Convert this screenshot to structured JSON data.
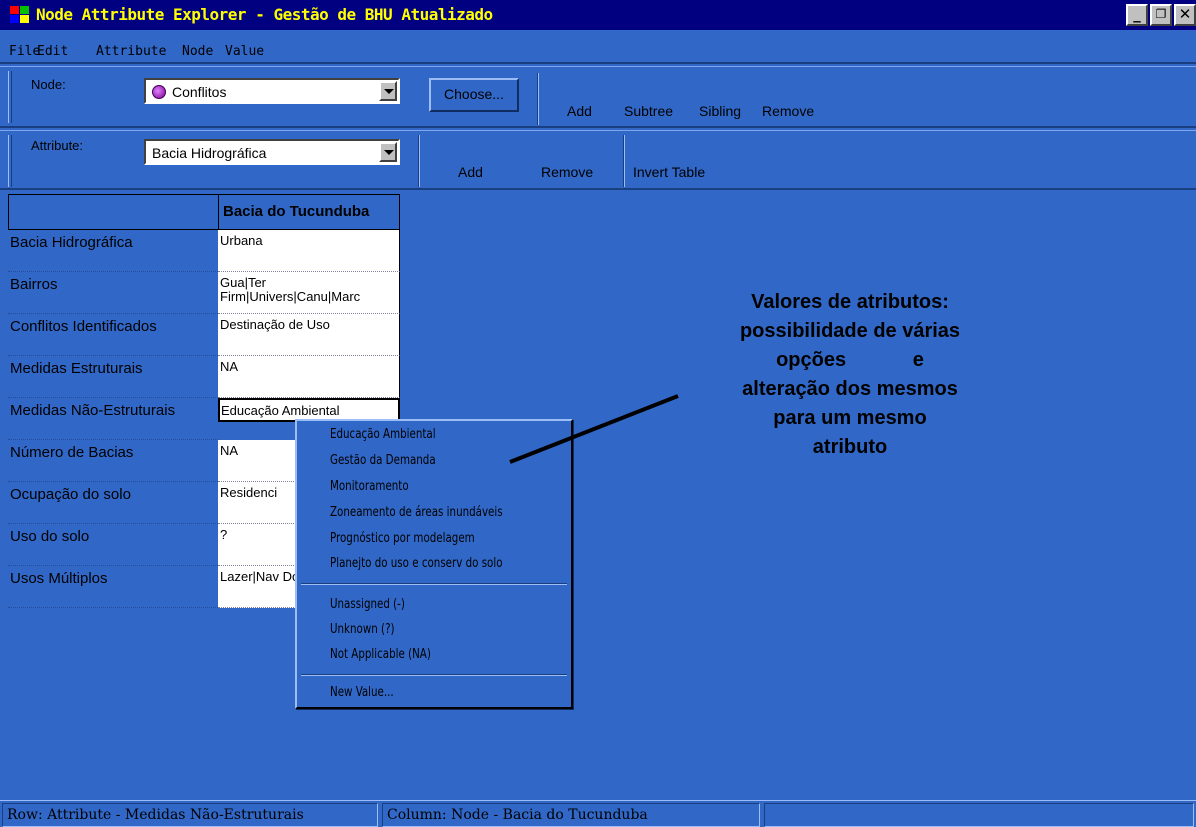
{
  "window": {
    "title": "Node Attribute Explorer - Gestão de BHU Atualizado"
  },
  "menu": [
    "File",
    "Edit",
    "Attribute",
    "Node",
    "Value"
  ],
  "node_toolbar": {
    "label": "Node:",
    "selected": "Conflitos",
    "choose_button": "Choose...",
    "actions": [
      "Add",
      "Subtree",
      "Sibling",
      "Remove"
    ]
  },
  "attribute_toolbar": {
    "label": "Attribute:",
    "selected": "Bacia Hidrográfica",
    "actions": [
      "Add",
      "Remove",
      "Invert Table"
    ]
  },
  "grid": {
    "column_header": "Bacia do Tucunduba",
    "rows": [
      {
        "attribute": "Bacia Hidrográfica",
        "value": "Urbana"
      },
      {
        "attribute": "Bairros",
        "value": "Gua|Ter Firm|Univers|Canu|Marc"
      },
      {
        "attribute": "Conflitos Identificados",
        "value": "Destinação de Uso"
      },
      {
        "attribute": "Medidas Estruturais",
        "value": "NA"
      },
      {
        "attribute": "Medidas Não-Estruturais",
        "value": "Educação Ambiental"
      },
      {
        "attribute": "Número de Bacias",
        "value": "NA"
      },
      {
        "attribute": "Ocupação do solo",
        "value": "Residenci"
      },
      {
        "attribute": "Uso do solo",
        "value": "?"
      },
      {
        "attribute": "Usos Múltiplos",
        "value": "Lazer|Nav Doméstico"
      }
    ]
  },
  "context_menu": {
    "values": [
      "Educação Ambiental",
      "Gestão da Demanda",
      "Monitoramento",
      "Zoneamento de áreas inundáveis",
      "Prognóstico por modelagem",
      "Planejto do uso e conserv do solo"
    ],
    "special": [
      "Unassigned (-)",
      "Unknown (?)",
      "Not Applicable (NA)"
    ],
    "new_value": "New Value..."
  },
  "annotation": {
    "lines": [
      "Valores de atributos:",
      "possibilidade de várias",
      "opções            e",
      "alteração dos mesmos",
      "para um mesmo",
      "atributo"
    ]
  },
  "status": {
    "row": "Row: Attribute - Medidas Não-Estruturais",
    "column": "Column: Node - Bacia do Tucunduba"
  },
  "colors": {
    "background": "#3168c8",
    "titlebar": "#000080",
    "title_text": "#ffff00"
  }
}
